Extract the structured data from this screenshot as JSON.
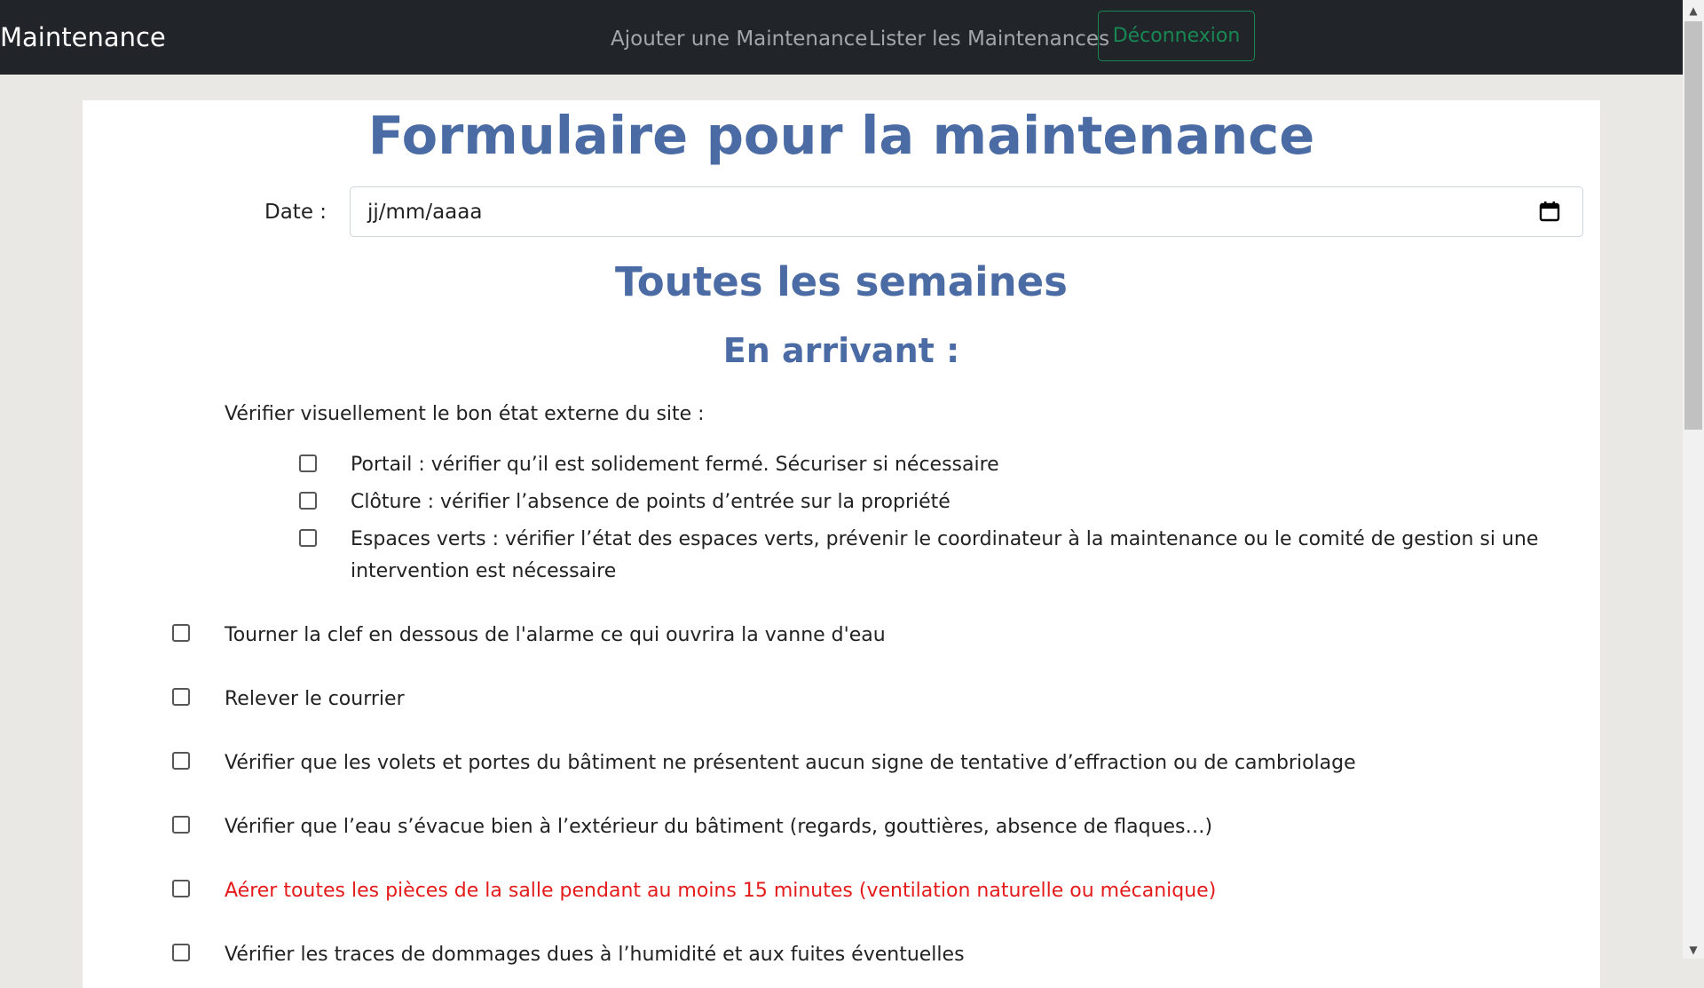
{
  "navbar": {
    "brand": "Maintenance",
    "links": [
      "Ajouter une Maintenance",
      "Lister les Maintenances"
    ],
    "logout_label": "Déconnexion"
  },
  "form": {
    "title": "Formulaire pour la maintenance",
    "date_label": "Date :",
    "date_placeholder": "jj/mm/aaaa",
    "section_title": "Toutes les semaines",
    "sub_title": "En arrivant :",
    "intro": "Vérifier visuellement le bon état externe du site :",
    "sub_items": [
      "Portail : vérifier qu’il est solidement fermé. Sécuriser si nécessaire",
      "Clôture : vérifier l’absence de points d’entrée sur la propriété",
      "Espaces verts : vérifier l’état des espaces verts, prévenir le coordinateur à la maintenance ou le comité de gestion si une",
      "intervention est nécessaire"
    ],
    "items": [
      "Tourner la clef en dessous de l'alarme ce qui ouvrira la vanne d'eau",
      "Relever le courrier",
      "Vérifier que les volets et portes du bâtiment ne présentent aucun signe de tentative d’effraction ou de cambriolage",
      "Vérifier que l’eau s’évacue bien à l’extérieur du bâtiment (regards, gouttières, absence de flaques…)",
      "Aérer toutes les pièces de la salle pendant au moins 15 minutes (ventilation naturelle ou mécanique)",
      "Vérifier les traces de dommages dues à l’humidité et aux fuites éventuelles"
    ],
    "highlight_color": "#e41b1b"
  }
}
